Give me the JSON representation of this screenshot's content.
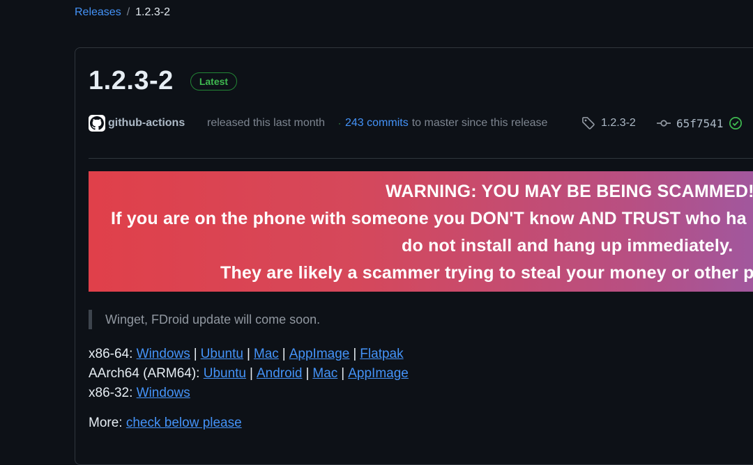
{
  "breadcrumb": {
    "releases": "Releases",
    "separator": "/",
    "current": "1.2.3-2"
  },
  "release": {
    "title": "1.2.3-2",
    "badge": "Latest",
    "author": "github-actions",
    "released_text": "released this last month",
    "commits_count": "243 commits",
    "commits_suffix": "to master since this release",
    "tag": "1.2.3-2",
    "commit_hash": "65f7541"
  },
  "warning": {
    "line1": "WARNING: YOU MAY BE BEING SCAMMED!",
    "line2": "If you are on the phone with someone you DON'T know AND TRUST who ha",
    "line3": "do not install and hang up immediately.",
    "line4": "They are likely a scammer trying to steal your money or other p"
  },
  "note": "Winget, FDroid update will come soon.",
  "downloads": [
    {
      "arch": "x86-64:",
      "links": [
        "Windows",
        "Ubuntu",
        "Mac",
        "AppImage",
        "Flatpak"
      ]
    },
    {
      "arch": "AArch64 (ARM64):",
      "links": [
        "Ubuntu",
        "Android",
        "Mac",
        "AppImage"
      ]
    },
    {
      "arch": "x86-32:",
      "links": [
        "Windows"
      ]
    }
  ],
  "more": {
    "label": "More:",
    "link": "check below please"
  },
  "colors": {
    "background": "#0d1117",
    "link": "#4493f8",
    "latest_badge": "#3fb950",
    "warning_gradient_start": "#e0404a",
    "warning_gradient_end": "#9f58a0"
  },
  "icons": [
    "github-logo-icon",
    "tag-icon",
    "git-commit-icon",
    "verified-check-icon"
  ]
}
